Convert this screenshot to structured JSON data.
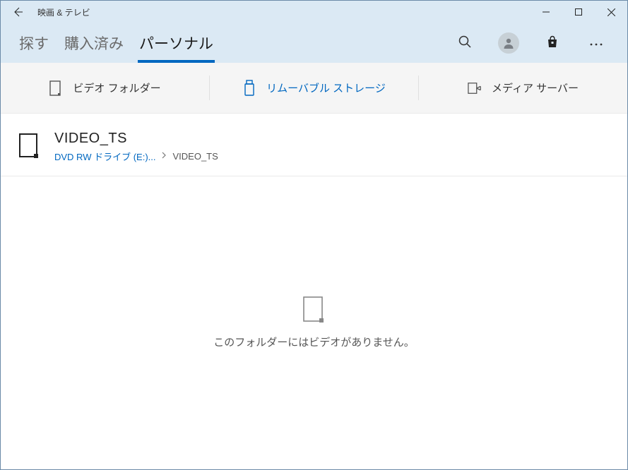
{
  "window": {
    "title": "映画 & テレビ"
  },
  "nav": {
    "tabs": [
      {
        "label": "探す"
      },
      {
        "label": "購入済み"
      },
      {
        "label": "パーソナル"
      }
    ],
    "active_index": 2
  },
  "sub_tabs": {
    "items": [
      {
        "label": "ビデオ フォルダー"
      },
      {
        "label": "リムーバブル ストレージ"
      },
      {
        "label": "メディア サーバー"
      }
    ],
    "active_index": 1
  },
  "folder": {
    "title": "VIDEO_TS",
    "breadcrumb": {
      "link": "DVD RW ドライブ (E:)...",
      "current": "VIDEO_TS"
    }
  },
  "empty": {
    "message": "このフォルダーにはビデオがありません。"
  },
  "colors": {
    "accent": "#0067c0",
    "header_bg": "#dbe9f4"
  }
}
